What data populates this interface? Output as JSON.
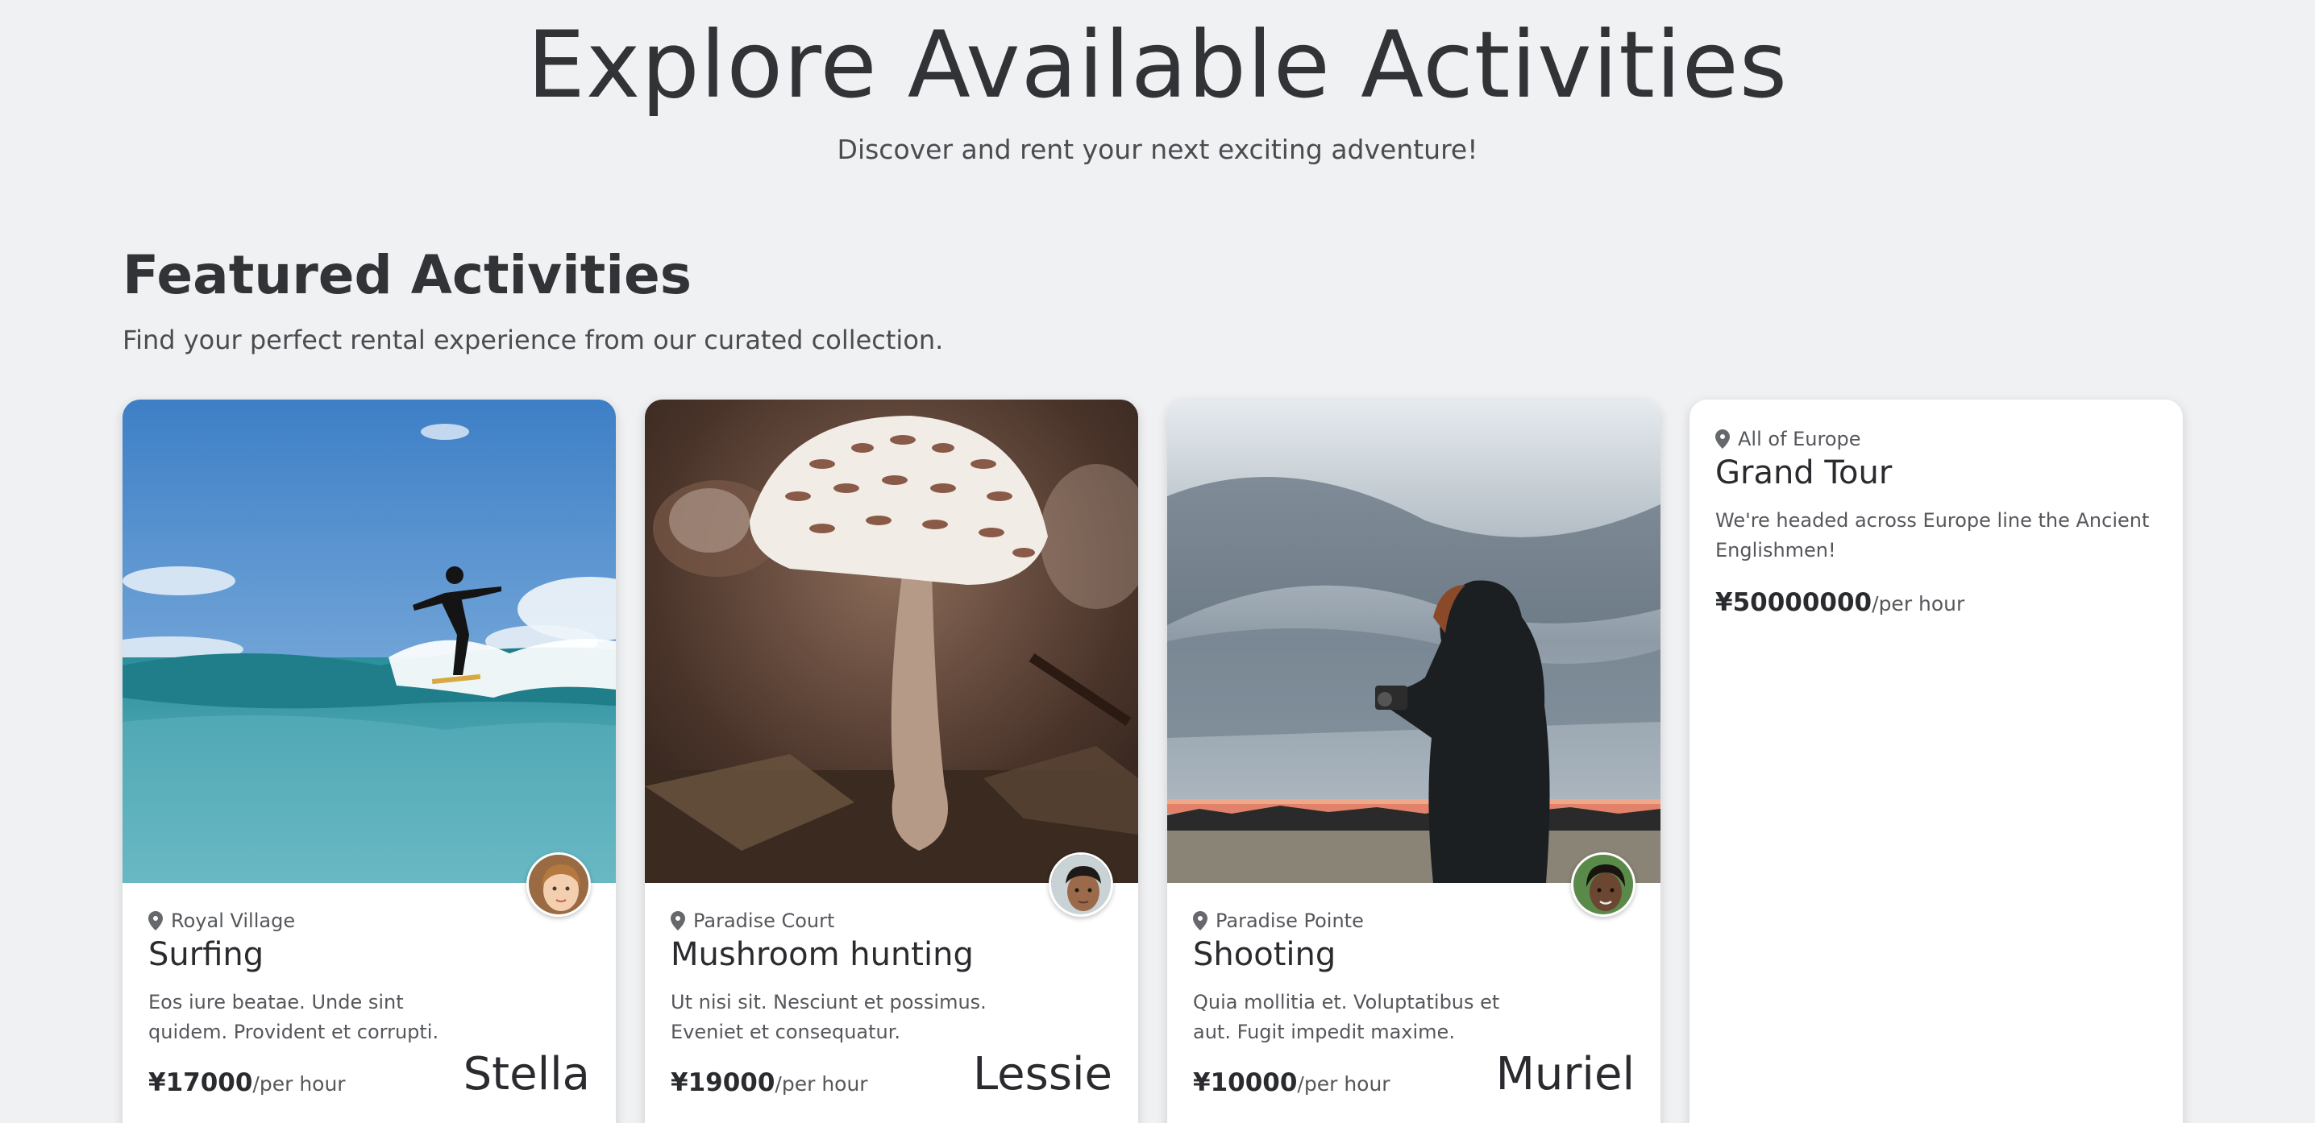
{
  "hero": {
    "title": "Explore Available Activities",
    "subtitle": "Discover and rent your next exciting adventure!"
  },
  "section": {
    "title": "Featured Activities",
    "subtitle": "Find your perfect rental experience from our curated collection."
  },
  "cards": [
    {
      "location": "Royal Village",
      "name": "Surfing",
      "description": "Eos iure beatae. Unde sint quidem. Provident et corrupti.",
      "price": "¥17000",
      "unit": "/per hour",
      "host": "Stella",
      "image": "surfer-on-wave-photo"
    },
    {
      "location": "Paradise Court",
      "name": "Mushroom hunting",
      "description": "Ut nisi sit. Nesciunt et possimus. Eveniet et consequatur.",
      "price": "¥19000",
      "unit": "/per hour",
      "host": "Lessie",
      "image": "mushroom-photo"
    },
    {
      "location": "Paradise Pointe",
      "name": "Shooting",
      "description": "Quia mollitia et. Voluptatibus et aut. Fugit impedit maxime.",
      "price": "¥10000",
      "unit": "/per hour",
      "host": "Muriel",
      "image": "photographer-at-sunset-photo"
    },
    {
      "location": "All of Europe",
      "name": "Grand Tour",
      "description": "We're headed across Europe line the Ancient Englishmen!",
      "price": "¥50000000",
      "unit": "/per hour"
    }
  ],
  "colors": {
    "background": "#f0f1f3",
    "card": "#ffffff",
    "text": "#2f3033"
  }
}
